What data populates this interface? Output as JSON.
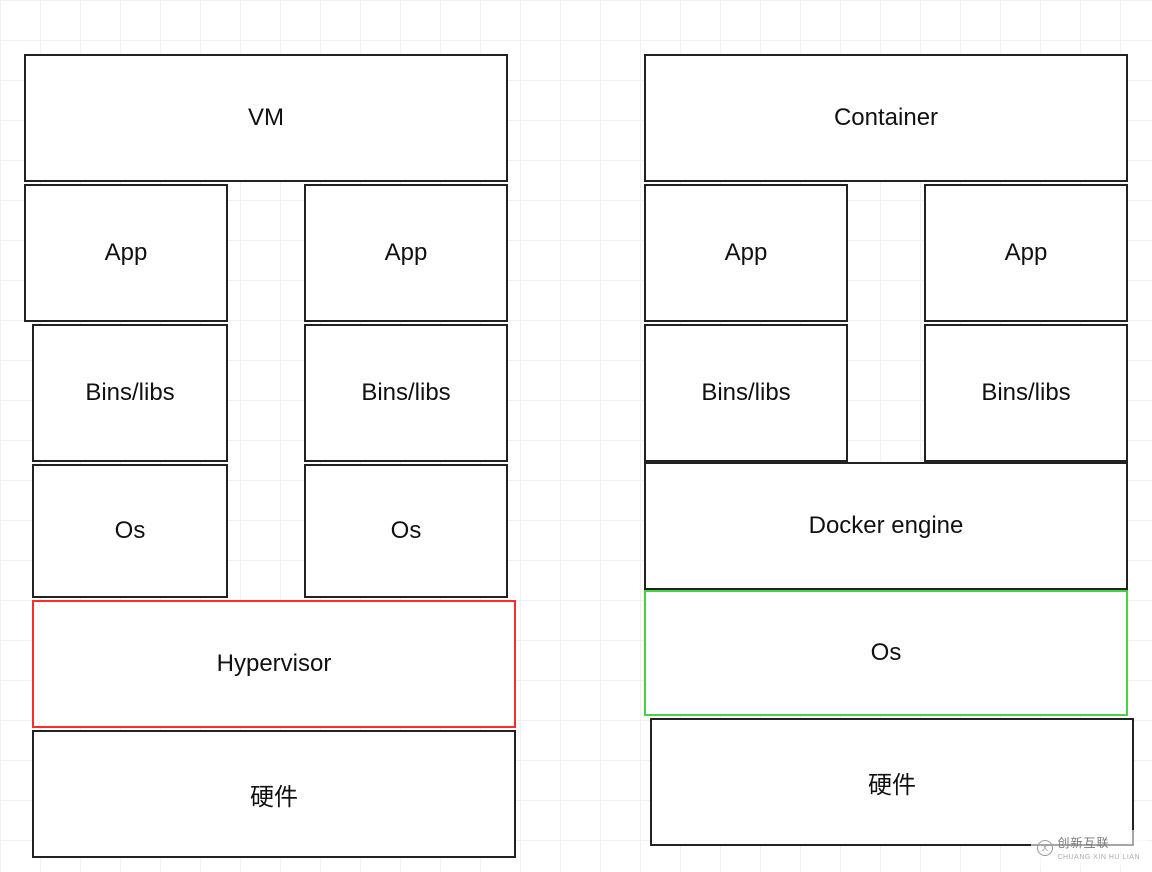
{
  "vm_stack": {
    "title": "VM",
    "apps": [
      "App",
      "App"
    ],
    "bins": [
      "Bins/libs",
      "Bins/libs"
    ],
    "os": [
      "Os",
      "Os"
    ],
    "hypervisor": "Hypervisor",
    "hardware": "硬件"
  },
  "container_stack": {
    "title": "Container",
    "apps": [
      "App",
      "App"
    ],
    "bins": [
      "Bins/libs",
      "Bins/libs"
    ],
    "engine": "Docker engine",
    "os": "Os",
    "hardware": "硬件"
  },
  "watermark": {
    "cn": "创新互联",
    "en": "CHUANG XIN HU LIAN"
  }
}
